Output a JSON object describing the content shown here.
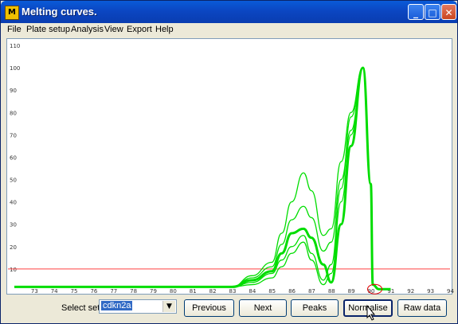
{
  "window": {
    "title": "Melting curves."
  },
  "title_buttons": {
    "minimize": "_",
    "maximize": "□",
    "close": "✕"
  },
  "menu": [
    "File",
    "Plate setup",
    "Analysis",
    "View",
    "Export",
    "Help"
  ],
  "chart_data": {
    "type": "line",
    "title": "",
    "xlabel": "",
    "ylabel": "",
    "y_ticks": [
      "110",
      "100",
      "90",
      "80",
      "70",
      "60",
      "50",
      "40",
      "30",
      "20",
      "10"
    ],
    "x_ticks": [
      "73",
      "74",
      "75",
      "76",
      "77",
      "78",
      "79",
      "80",
      "81",
      "82",
      "83",
      "84",
      "85",
      "86",
      "87",
      "88",
      "89",
      "90",
      "91",
      "92",
      "93",
      "94"
    ],
    "ylim": [
      0,
      110
    ],
    "xlim": [
      72,
      94
    ],
    "threshold": 10,
    "colors": {
      "curves": "#00dd00",
      "threshold": "#ff4040",
      "marker": "#e00000"
    },
    "series": [
      {
        "x": [
          72,
          83,
          84,
          85,
          85.5,
          86,
          86.6,
          87,
          87.6,
          88,
          88.5,
          89,
          89.6,
          90,
          90.1,
          90.4,
          91
        ],
        "values": [
          2,
          2,
          5,
          9,
          17,
          26,
          28,
          24,
          12,
          4,
          30,
          65,
          100,
          48,
          3,
          1,
          1
        ]
      },
      {
        "x": [
          72,
          83,
          84,
          85,
          85.5,
          86,
          86.6,
          87,
          87.6,
          88,
          88.5,
          89,
          89.6,
          90,
          90.1,
          90.4,
          91
        ],
        "values": [
          2,
          2,
          6,
          11,
          21,
          32,
          38,
          33,
          18,
          22,
          50,
          72,
          100,
          48,
          3,
          1,
          1
        ]
      },
      {
        "x": [
          72,
          83,
          84,
          85,
          85.5,
          86,
          86.6,
          87,
          87.6,
          88,
          88.5,
          89,
          89.6,
          90,
          90.1,
          90.4,
          91
        ],
        "values": [
          2,
          2,
          7,
          13,
          26,
          40,
          53,
          45,
          25,
          28,
          58,
          80,
          100,
          48,
          3,
          1,
          1
        ]
      },
      {
        "x": [
          72,
          83,
          84,
          85,
          85.5,
          86,
          86.6,
          87,
          87.6,
          88,
          88.5,
          89,
          89.6,
          90,
          90.1,
          90.4,
          91
        ],
        "values": [
          2,
          2,
          3,
          6,
          11,
          17,
          22,
          14,
          3,
          8,
          40,
          70,
          100,
          48,
          3,
          1,
          1
        ]
      },
      {
        "x": [
          72,
          83,
          84,
          85,
          85.5,
          86,
          86.6,
          87,
          87.6,
          88,
          88.5,
          89,
          89.6,
          90,
          90.1,
          90.4,
          91
        ],
        "values": [
          2,
          2,
          4,
          8,
          14,
          20,
          25,
          17,
          5,
          12,
          46,
          78,
          100,
          48,
          3,
          1,
          1
        ]
      }
    ],
    "marker": {
      "x": 90.2,
      "y": 1
    }
  },
  "bottom": {
    "select_label": "Select set",
    "select_value": "cdkn2a",
    "select_arrow": "▼",
    "previous": "Previous",
    "next": "Next",
    "peaks": "Peaks",
    "normalise": "Normalise",
    "raw_data": "Raw data"
  }
}
